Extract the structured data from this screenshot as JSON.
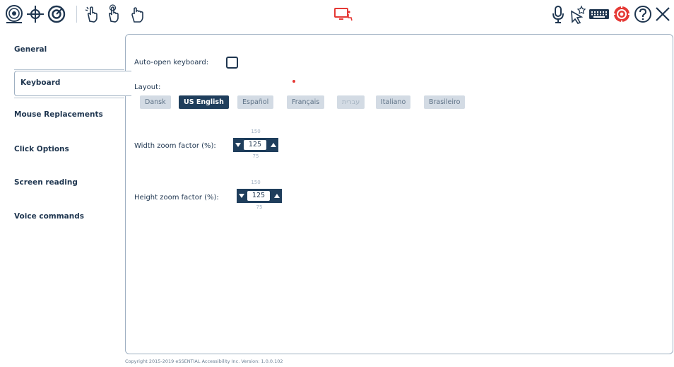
{
  "toolbar": {
    "left_icons": [
      "target-icon",
      "crosshair-icon",
      "target-ring-icon",
      "hand-pointer-icon",
      "hand-click-icon",
      "hand-grab-icon"
    ],
    "center_icon": "accessibility-monitor-icon",
    "right_icons": [
      "microphone-icon",
      "pointer-star-icon",
      "keyboard-icon",
      "settings-gear-icon",
      "help-icon",
      "close-icon"
    ],
    "accent_color": "#1f3e5c",
    "alert_color": "#e53935"
  },
  "sidebar": {
    "items": [
      {
        "label": "General"
      },
      {
        "label": "Keyboard"
      },
      {
        "label": "Mouse Replacements"
      },
      {
        "label": "Click Options"
      },
      {
        "label": "Screen reading"
      },
      {
        "label": "Voice commands"
      }
    ],
    "active": "Keyboard"
  },
  "keyboard": {
    "auto_open_label": "Auto-open keyboard:",
    "auto_open_checked": false,
    "layout_label": "Layout:",
    "layouts": [
      {
        "label": "Dansk",
        "state": "normal"
      },
      {
        "label": "US English",
        "state": "selected"
      },
      {
        "label": "Español",
        "state": "normal"
      },
      {
        "label": "Français",
        "state": "normal"
      },
      {
        "label": "עברית",
        "state": "disabled"
      },
      {
        "label": "Italiano",
        "state": "normal"
      },
      {
        "label": "Brasileiro",
        "state": "normal"
      }
    ],
    "width_zoom": {
      "label": "Width zoom factor (%):",
      "value": "125",
      "max": "150",
      "min": "75"
    },
    "height_zoom": {
      "label": "Height zoom factor (%):",
      "value": "125",
      "max": "150",
      "min": "75"
    }
  },
  "footer": {
    "text": "Copyright 2015-2019 eSSENTIAL Accessibility Inc.  Version: 1.0.0.102"
  }
}
